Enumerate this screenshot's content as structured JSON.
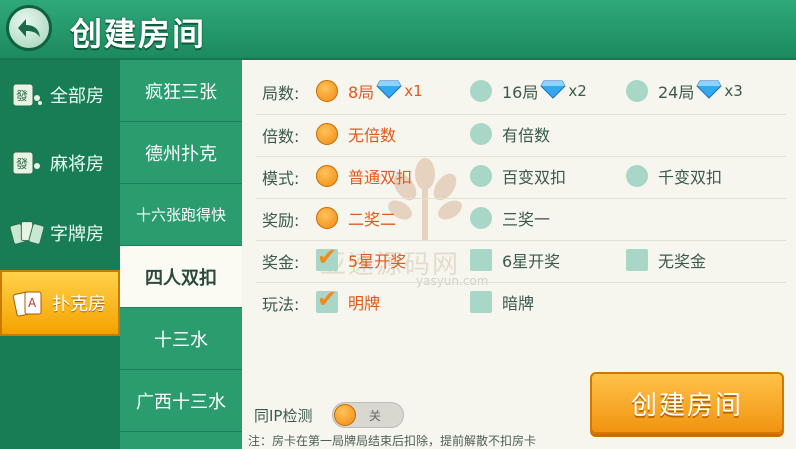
{
  "header": {
    "title": "创建房间"
  },
  "categories": [
    {
      "label": "全部房",
      "icon": "mahjong-tile-icon"
    },
    {
      "label": "麻将房",
      "icon": "mahjong-tile-icon"
    },
    {
      "label": "字牌房",
      "icon": "character-cards-icon"
    },
    {
      "label": "扑克房",
      "icon": "poker-cards-icon",
      "active": true
    }
  ],
  "games": [
    {
      "label": "疯狂三张"
    },
    {
      "label": "德州扑克"
    },
    {
      "label": "十六张跑得快"
    },
    {
      "label": "四人双扣",
      "active": true
    },
    {
      "label": "十三水"
    },
    {
      "label": "广西十三水"
    }
  ],
  "settings": {
    "rounds": {
      "label": "局数:",
      "options": [
        {
          "text": "8局",
          "multiplier": "x1",
          "icon": "diamond-icon",
          "selected": true
        },
        {
          "text": "16局",
          "multiplier": "x2",
          "icon": "diamond-icon"
        },
        {
          "text": "24局",
          "multiplier": "x3",
          "icon": "diamond-icon"
        }
      ]
    },
    "multiple": {
      "label": "倍数:",
      "options": [
        {
          "text": "无倍数",
          "selected": true
        },
        {
          "text": "有倍数"
        }
      ]
    },
    "mode": {
      "label": "模式:",
      "options": [
        {
          "text": "普通双扣",
          "selected": true
        },
        {
          "text": "百变双扣"
        },
        {
          "text": "千变双扣"
        }
      ]
    },
    "reward": {
      "label": "奖励:",
      "options": [
        {
          "text": "二奖二",
          "selected": true
        },
        {
          "text": "三奖一"
        }
      ]
    },
    "bonus": {
      "label": "奖金:",
      "options": [
        {
          "text": "5星开奖",
          "selected": true
        },
        {
          "text": "6星开奖"
        },
        {
          "text": "无奖金"
        }
      ]
    },
    "play": {
      "label": "玩法:",
      "options": [
        {
          "text": "明牌",
          "selected": true
        },
        {
          "text": "暗牌"
        }
      ]
    }
  },
  "ip_check": {
    "label": "同IP检测",
    "toggle_text": "关"
  },
  "note": "注：房卡在第一局牌局结束后扣除，提前解散不扣房卡",
  "create_button": "创建房间",
  "watermark": {
    "text": "亚速源码网",
    "sub": "yasyun.com"
  },
  "colors": {
    "accent": "#f19410",
    "header": "#2fa97a",
    "selected_text": "#e05a1e"
  }
}
